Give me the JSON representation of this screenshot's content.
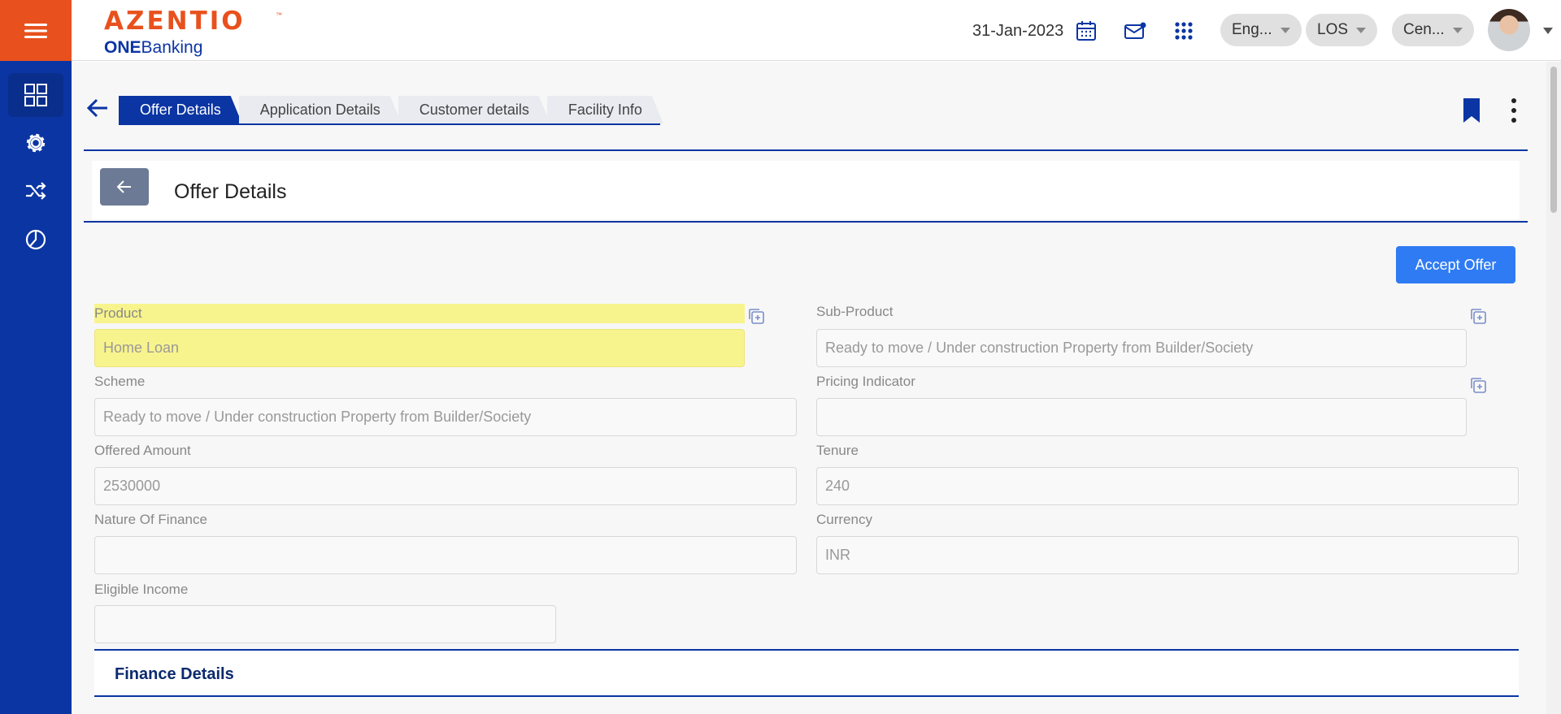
{
  "brand": {
    "name": "AZENTIO",
    "tm": "™",
    "sub_bold": "ONE",
    "sub_rest": "Banking"
  },
  "header": {
    "date": "31-Jan-2023",
    "language": "Eng...",
    "module": "LOS",
    "branch": "Cen..."
  },
  "tabs": [
    "Offer Details",
    "Application Details",
    "Customer details",
    "Facility Info"
  ],
  "page": {
    "title": "Offer Details",
    "accept_label": "Accept Offer"
  },
  "form": {
    "product": {
      "label": "Product",
      "value": "Home Loan"
    },
    "sub_product": {
      "label": "Sub-Product",
      "value": "Ready to move / Under construction Property from Builder/Society"
    },
    "scheme": {
      "label": "Scheme",
      "value": "Ready to move / Under construction Property from Builder/Society"
    },
    "pricing_indicator": {
      "label": "Pricing Indicator",
      "value": ""
    },
    "offered_amount": {
      "label": "Offered Amount",
      "value": "2530000"
    },
    "tenure": {
      "label": "Tenure",
      "value": "240"
    },
    "nature_of_finance": {
      "label": "Nature Of Finance",
      "value": ""
    },
    "currency": {
      "label": "Currency",
      "value": "INR"
    },
    "eligible_income": {
      "label": "Eligible Income",
      "value": ""
    }
  },
  "section": {
    "title": "Finance Details"
  },
  "colors": {
    "sidebar": "#0b35a3",
    "menu": "#e8511d",
    "accent": "#2f7bf3",
    "highlight": "#f8f48d"
  }
}
